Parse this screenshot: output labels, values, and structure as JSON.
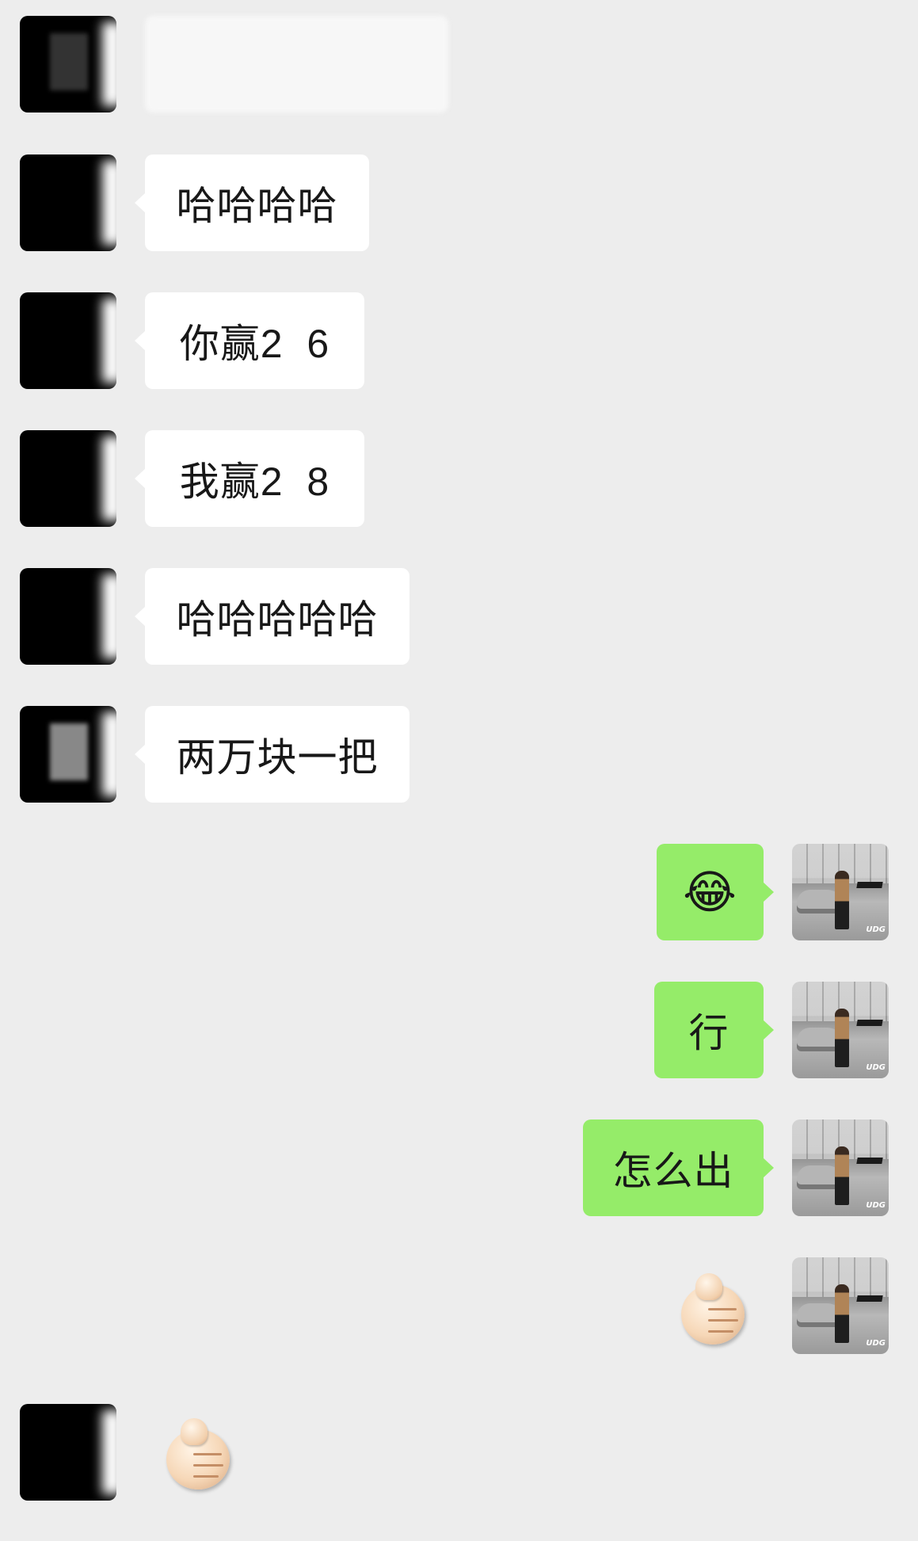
{
  "messages": [
    {
      "side": "left",
      "text": "哈哈哈哈"
    },
    {
      "side": "left",
      "text": "你赢2  6"
    },
    {
      "side": "left",
      "text": "我赢2  8"
    },
    {
      "side": "left",
      "text": "哈哈哈哈哈"
    },
    {
      "side": "left",
      "text": "两万块一把"
    },
    {
      "side": "right",
      "text": "😂"
    },
    {
      "side": "right",
      "text": "行"
    },
    {
      "side": "right",
      "text": "怎么出"
    }
  ],
  "stickers": [
    {
      "side": "right",
      "name": "fist-thumb-sticker"
    },
    {
      "side": "left",
      "name": "fist-thumb-sticker"
    }
  ],
  "self_avatar": {
    "watermark_text": "UDG"
  },
  "colors": {
    "background": "#ededed",
    "incoming_bubble": "#ffffff",
    "outgoing_bubble": "#95ec69"
  }
}
